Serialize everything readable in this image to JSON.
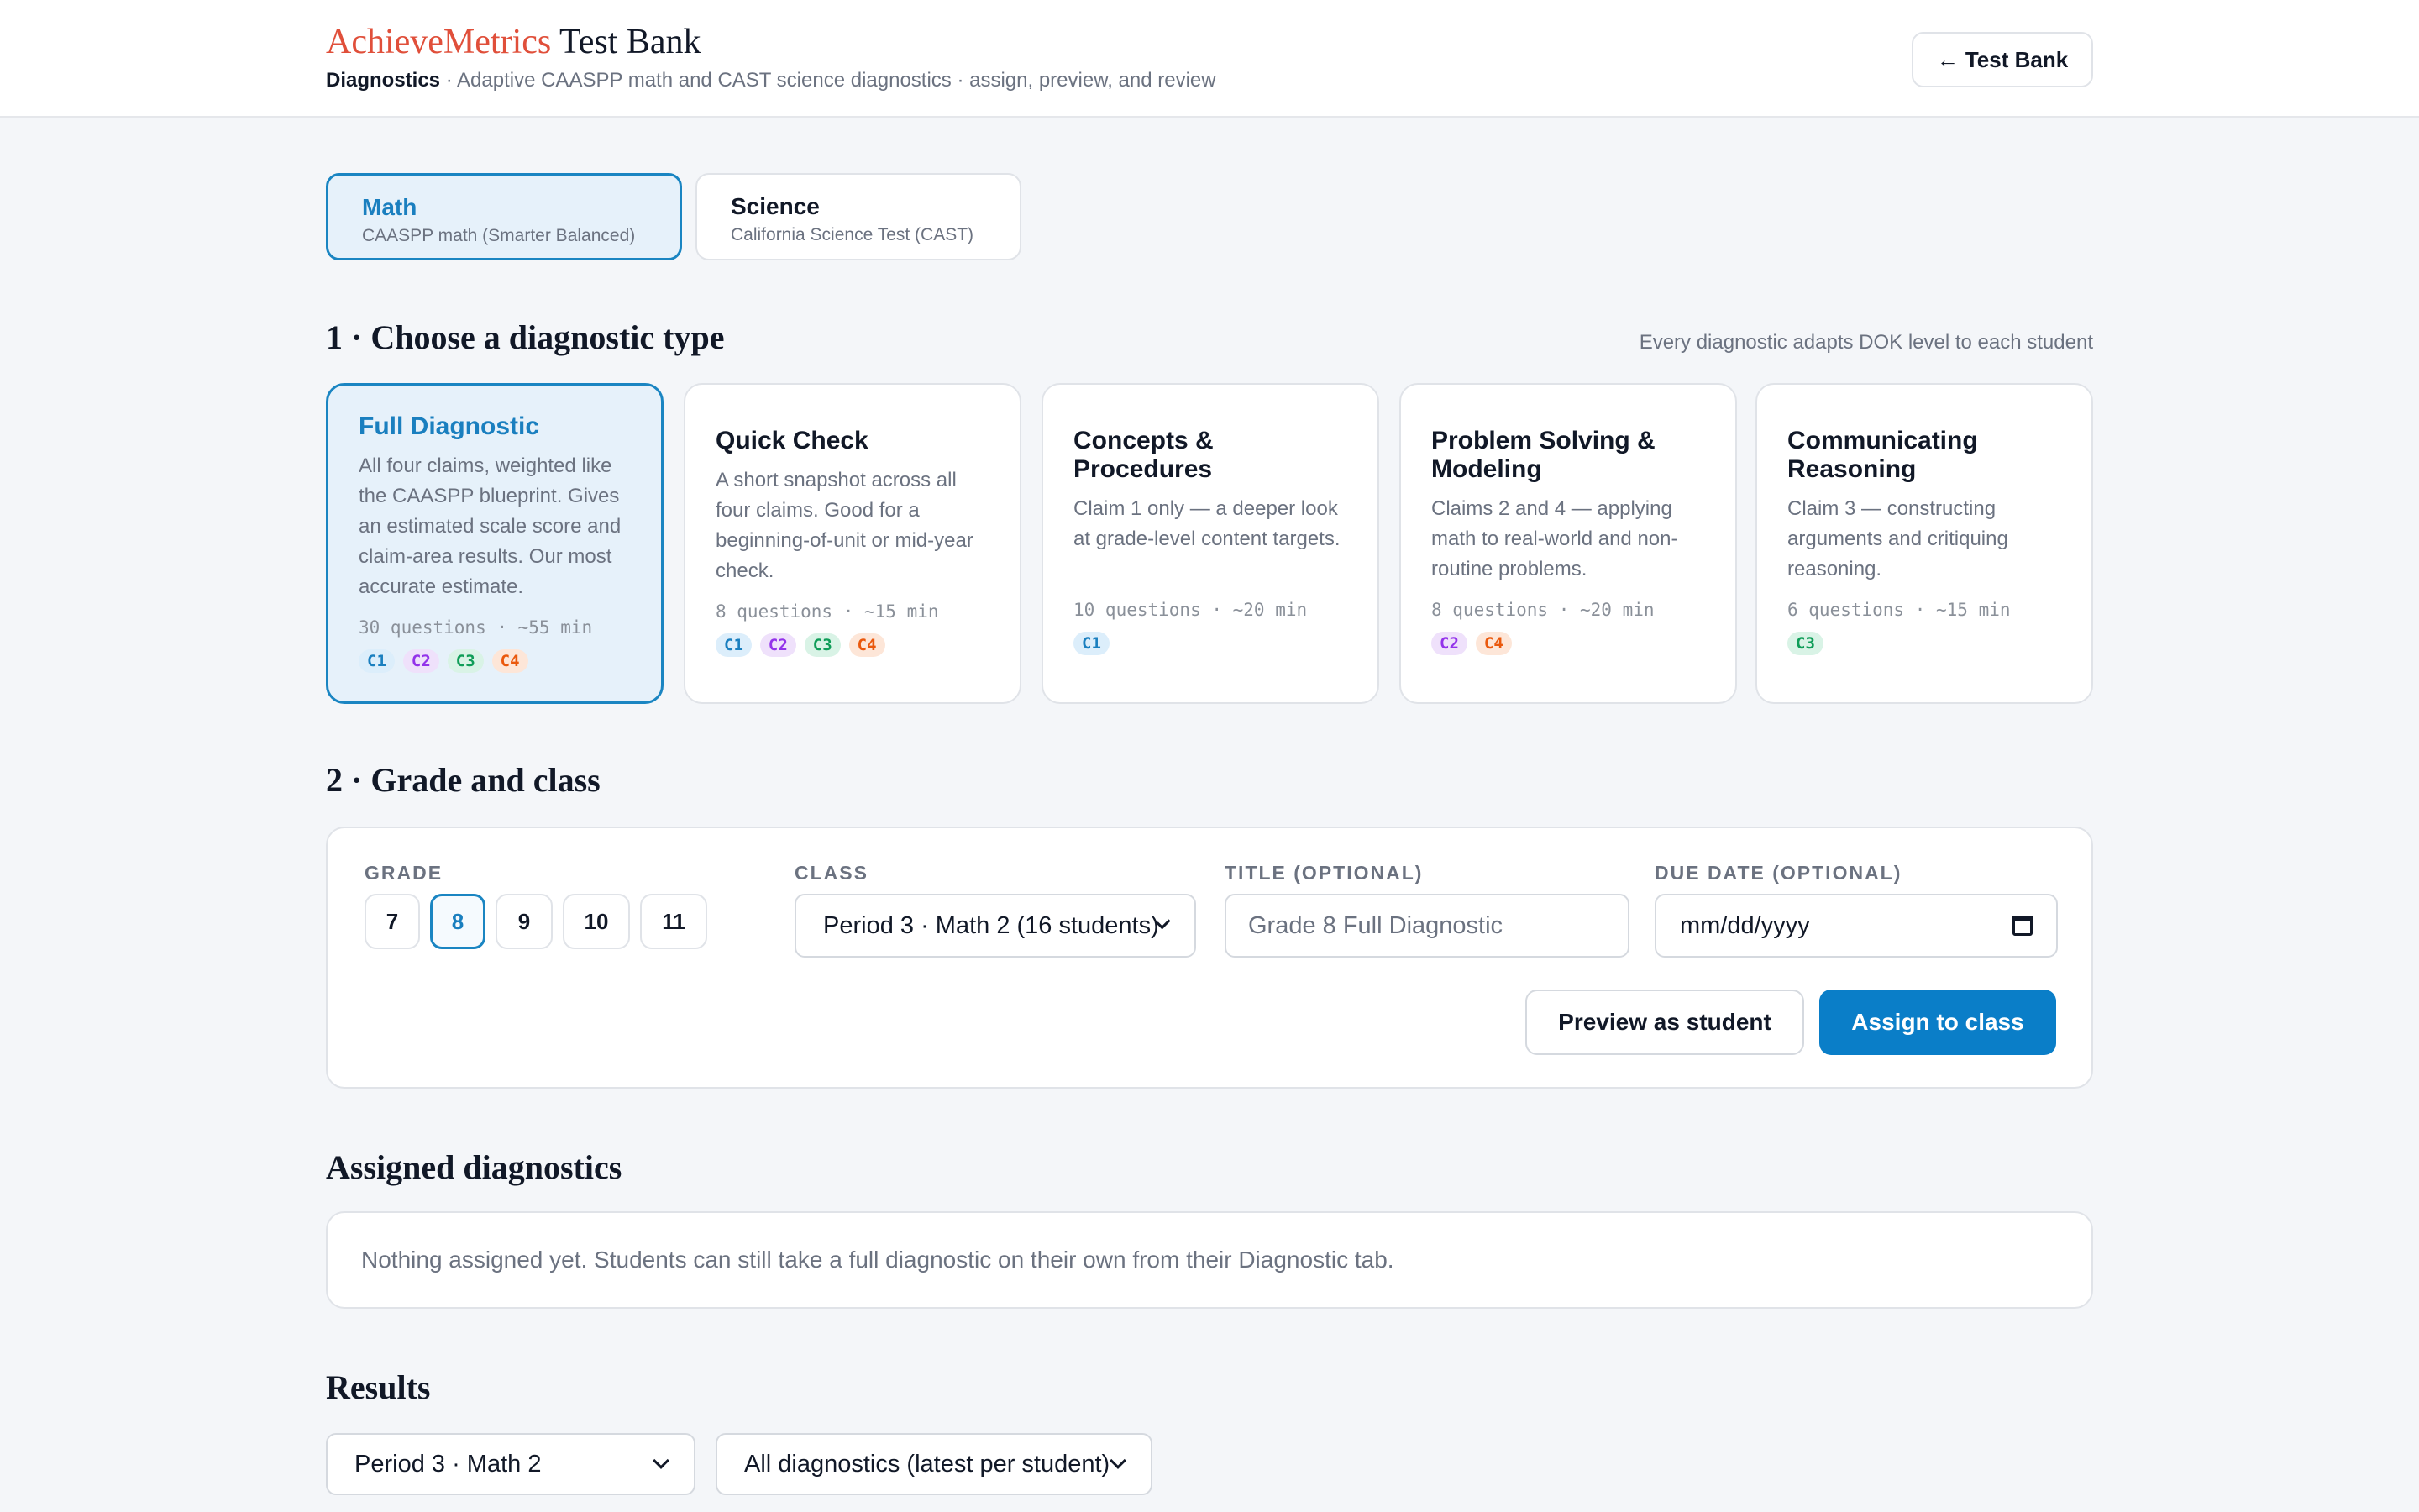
{
  "header": {
    "brand_accent": "AchieveMetrics",
    "brand_rest": " Test Bank",
    "section": "Diagnostics",
    "description": " · Adaptive CAASPP math and CAST science diagnostics · assign, preview, and review",
    "back_arrow": "←",
    "back_label": "Test Bank"
  },
  "subjects": [
    {
      "title": "Math",
      "subtitle": "CAASPP math (Smarter Balanced)",
      "selected": true
    },
    {
      "title": "Science",
      "subtitle": "California Science Test (CAST)",
      "selected": false
    }
  ],
  "step1": {
    "title": "1 · Choose a diagnostic type",
    "note": "Every diagnostic adapts DOK level to each student"
  },
  "diagnostics": [
    {
      "title": "Full Diagnostic",
      "desc": "All four claims, weighted like the CAASPP blueprint. Gives an estimated scale score and claim-area results. Our most accurate estimate.",
      "meta": "30 questions · ~55 min",
      "claims": [
        "C1",
        "C2",
        "C3",
        "C4"
      ],
      "selected": true
    },
    {
      "title": "Quick Check",
      "desc": "A short snapshot across all four claims. Good for a beginning-of-unit or mid-year check.",
      "meta": "8 questions · ~15 min",
      "claims": [
        "C1",
        "C2",
        "C3",
        "C4"
      ],
      "selected": false
    },
    {
      "title": "Concepts & Procedures",
      "desc": "Claim 1 only — a deeper look at grade-level content targets.",
      "meta": "10 questions · ~20 min",
      "claims": [
        "C1"
      ],
      "selected": false
    },
    {
      "title": "Problem Solving & Modeling",
      "desc": "Claims 2 and 4 — applying math to real-world and non-routine problems.",
      "meta": "8 questions · ~20 min",
      "claims": [
        "C2",
        "C4"
      ],
      "selected": false
    },
    {
      "title": "Communicating Reasoning",
      "desc": "Claim 3 — constructing arguments and critiquing reasoning.",
      "meta": "6 questions · ~15 min",
      "claims": [
        "C3"
      ],
      "selected": false
    }
  ],
  "step2": {
    "title": "2 · Grade and class",
    "grade_label": "GRADE",
    "grades": [
      "7",
      "8",
      "9",
      "10",
      "11"
    ],
    "selected_grade": "8",
    "class_label": "CLASS",
    "class_value": "Period 3 · Math 2 (16 students)",
    "title_label": "TITLE (OPTIONAL)",
    "title_placeholder": "Grade 8 Full Diagnostic",
    "due_label": "DUE DATE (OPTIONAL)",
    "due_value": "mm/dd/yyyy",
    "preview_label": "Preview as student",
    "assign_label": "Assign to class"
  },
  "assigned": {
    "title": "Assigned diagnostics",
    "empty_text": "Nothing assigned yet. Students can still take a full diagnostic on their own from their Diagnostic tab."
  },
  "results": {
    "title": "Results",
    "class_filter": "Period 3 · Math 2",
    "diag_filter": "All diagnostics (latest per student)"
  },
  "colors": {
    "brand_accent": "#e04f3a",
    "primary": "#0a7ec8",
    "selected_bg": "#e6f1fa",
    "c1": "#1a7fbf",
    "c2": "#9333ea",
    "c3": "#0f9d58",
    "c4": "#ea580c"
  },
  "icons": {
    "back": "arrow-left-icon",
    "select": "chevron-down-icon",
    "date": "calendar-icon"
  }
}
